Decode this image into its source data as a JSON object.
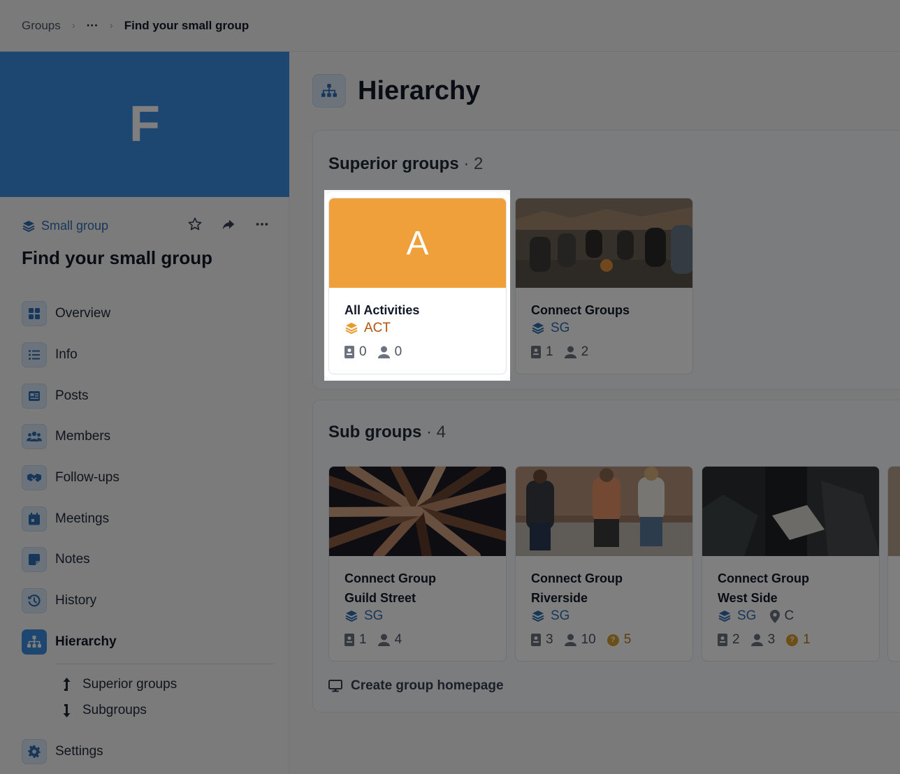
{
  "breadcrumb": {
    "items": [
      "Groups",
      "···",
      "Find your small group"
    ]
  },
  "sidebar": {
    "cover_letter": "F",
    "group_type": "Small group",
    "title": "Find your small group",
    "nav": [
      {
        "label": "Overview",
        "icon": "grid-icon"
      },
      {
        "label": "Info",
        "icon": "list-icon"
      },
      {
        "label": "Posts",
        "icon": "newspaper-icon"
      },
      {
        "label": "Members",
        "icon": "users-icon"
      },
      {
        "label": "Follow-ups",
        "icon": "handshake-icon"
      },
      {
        "label": "Meetings",
        "icon": "calendar-icon"
      },
      {
        "label": "Notes",
        "icon": "note-icon"
      },
      {
        "label": "History",
        "icon": "history-icon"
      },
      {
        "label": "Hierarchy",
        "icon": "hierarchy-icon"
      }
    ],
    "subnav": [
      {
        "label": "Superior groups",
        "icon": "arrow-up-icon"
      },
      {
        "label": "Subgroups",
        "icon": "arrow-down-icon"
      }
    ],
    "settings_label": "Settings"
  },
  "main": {
    "title": "Hierarchy",
    "superior": {
      "heading": "Superior groups",
      "count": "2",
      "cards": [
        {
          "name": "All Activities",
          "tag": "ACT",
          "cover_letter": "A",
          "leaders": "0",
          "members": "0"
        },
        {
          "name": "Connect Groups",
          "tag": "SG",
          "leaders": "1",
          "members": "2"
        }
      ]
    },
    "sub": {
      "heading": "Sub groups",
      "count": "4",
      "cards": [
        {
          "name_line1": "Connect Group",
          "name_line2": "Guild Street",
          "tag": "SG",
          "leaders": "1",
          "members": "4"
        },
        {
          "name_line1": "Connect Group",
          "name_line2": "Riverside",
          "tag": "SG",
          "leaders": "3",
          "members": "10",
          "pending": "5"
        },
        {
          "name_line1": "Connect Group",
          "name_line2": "West Side",
          "tag": "SG",
          "location": "C",
          "leaders": "2",
          "members": "3",
          "pending": "1"
        }
      ],
      "create_label": "Create group homepage"
    }
  },
  "colors": {
    "accent": "#3b8de0",
    "activity_orange": "#f0a03a",
    "pending": "#d69e2e"
  }
}
